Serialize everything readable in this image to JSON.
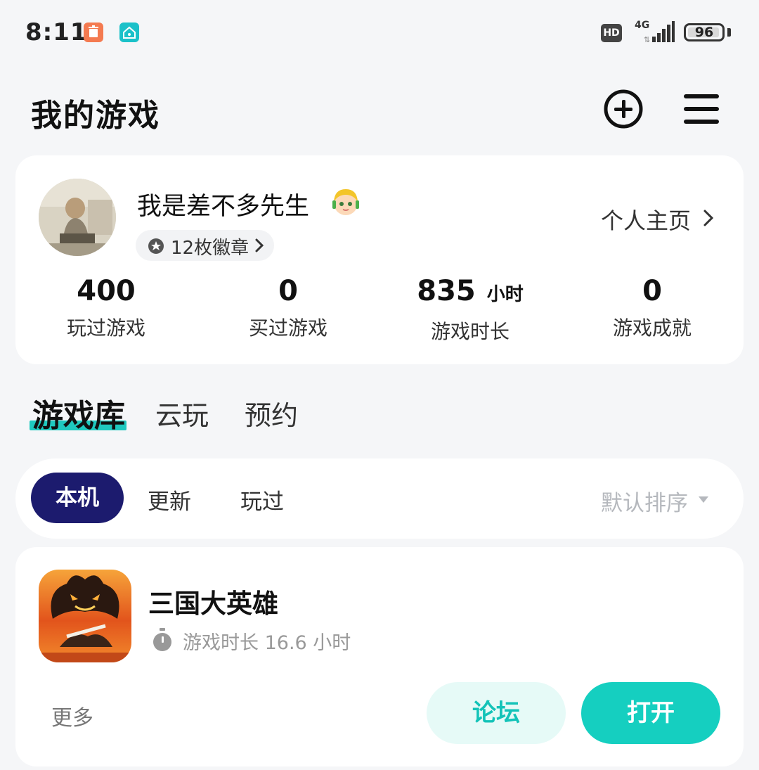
{
  "status_bar": {
    "time": "8:11",
    "hd_label": "HD",
    "network_label": "4G",
    "battery_level": "96"
  },
  "header": {
    "title": "我的游戏"
  },
  "profile": {
    "username": "我是差不多先生",
    "badges_label": "12枚徽章",
    "homepage_label": "个人主页",
    "stats": [
      {
        "value": "400",
        "unit": "",
        "label": "玩过游戏"
      },
      {
        "value": "0",
        "unit": "",
        "label": "买过游戏"
      },
      {
        "value": "835",
        "unit": "小时",
        "label": "游戏时长"
      },
      {
        "value": "0",
        "unit": "",
        "label": "游戏成就"
      }
    ]
  },
  "tabs": [
    {
      "label": "游戏库",
      "active": true
    },
    {
      "label": "云玩",
      "active": false
    },
    {
      "label": "预约",
      "active": false
    }
  ],
  "filters": {
    "chips": [
      {
        "label": "本机",
        "active": true
      },
      {
        "label": "更新",
        "active": false
      },
      {
        "label": "玩过",
        "active": false
      }
    ],
    "sort_label": "默认排序"
  },
  "game": {
    "name": "三国大英雄",
    "playtime_label": "游戏时长 16.6 小时",
    "more_label": "更多",
    "forum_label": "论坛",
    "open_label": "打开"
  },
  "colors": {
    "accent": "#15cfc0",
    "chip_active_bg": "#1c1b6e",
    "background": "#f5f6f8"
  }
}
